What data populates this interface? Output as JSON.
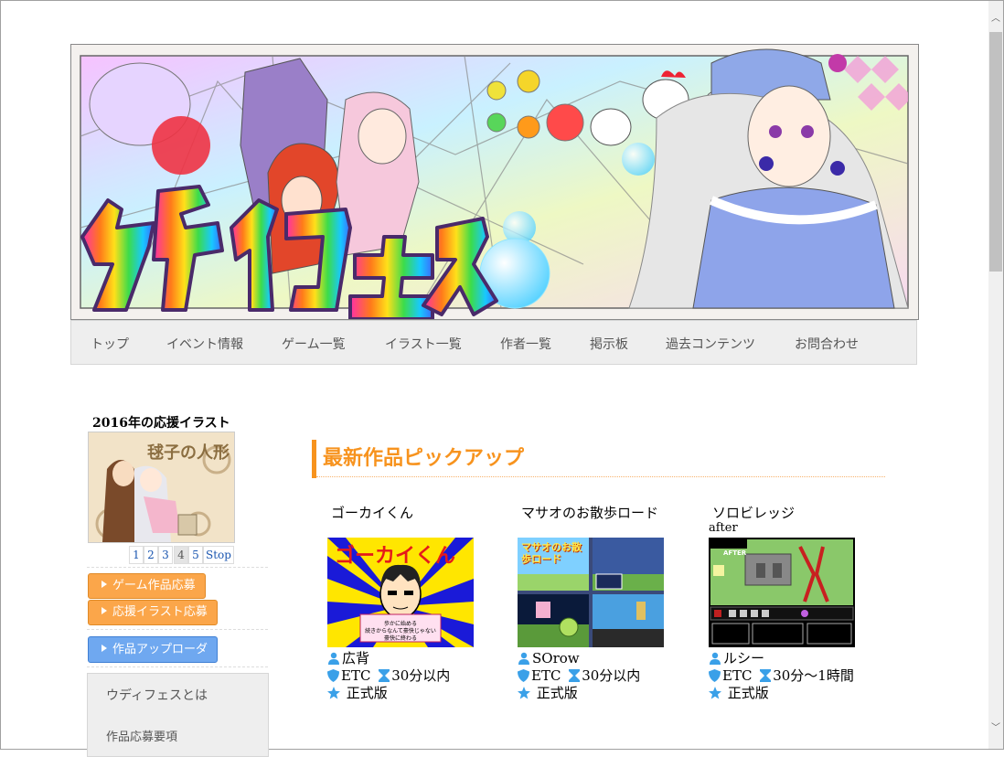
{
  "banner": {
    "logo_text": "ウディフェス"
  },
  "nav": {
    "items": [
      "トップ",
      "イベント情報",
      "ゲーム一覧",
      "イラスト一覧",
      "作者一覧",
      "掲示板",
      "過去コンテンツ",
      "お問合わせ"
    ]
  },
  "sidebar": {
    "illust_title": "2016年の応援イラスト",
    "illust_caption": "毬子の人形",
    "pager": [
      "1",
      "2",
      "3",
      "4",
      "5",
      "Stop"
    ],
    "pager_active": "4",
    "buttons": {
      "game_entry": "ゲーム作品応募",
      "illust_entry": "応援イラスト応募",
      "uploader": "作品アップローダ"
    },
    "menu": [
      "ウディフェスとは",
      "作品応募要項"
    ]
  },
  "main": {
    "heading": "最新作品ピックアップ",
    "cards": [
      {
        "title": "ゴーカイくん",
        "title_line2": "",
        "author": "広背",
        "genre": "ETC",
        "time": "30分以内",
        "status": "正式版",
        "thumb_text": "ゴーカイくん"
      },
      {
        "title": "マサオのお散歩ロード",
        "title_line2": "",
        "author": "SOrow",
        "genre": "ETC",
        "time": "30分以内",
        "status": "正式版",
        "thumb_text": "マサオのお散歩ロード"
      },
      {
        "title": "ソロビレッジ",
        "title_line2": "after",
        "author": "ルシー",
        "genre": "ETC",
        "time": "30分～1時間",
        "status": "正式版",
        "thumb_text": "AFTER"
      }
    ]
  },
  "colors": {
    "accent": "#f7931e",
    "button_orange": "#fba64a",
    "button_blue": "#6fa8f0",
    "nav_bg": "#eeeeee",
    "icon_blue": "#3aa0e8"
  }
}
